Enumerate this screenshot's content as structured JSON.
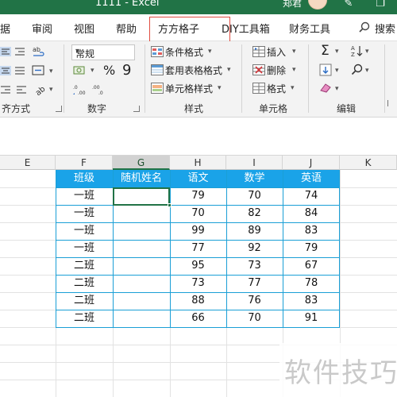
{
  "window": {
    "title": "1111  -  Excel",
    "user_name": "郑君"
  },
  "menu": {
    "tabs": [
      "据",
      "审阅",
      "视图",
      "帮助",
      "方方格子",
      "DIY工具箱",
      "财务工具"
    ],
    "search_label": "搜索"
  },
  "ribbon": {
    "alignment_group": "齐方式",
    "number": {
      "format_value": "常规",
      "percent_symbol": "%",
      "comma_symbol": "9",
      "group_label": "数字"
    },
    "styles": {
      "conditional_format": "条件格式",
      "format_as_table": "套用表格格式",
      "cell_styles": "单元格样式",
      "group_label": "样式"
    },
    "cells": {
      "insert": "插入",
      "delete": "删除",
      "format": "格式",
      "group_label": "单元格"
    },
    "editing": {
      "group_label": "编辑"
    }
  },
  "sheet": {
    "columns": [
      "E",
      "F",
      "G",
      "H",
      "I",
      "J",
      "K"
    ],
    "selected_column": "G",
    "table": {
      "headers": [
        "班级",
        "随机姓名",
        "语文",
        "数学",
        "英语"
      ],
      "rows": [
        [
          "一班",
          "",
          "79",
          "70",
          "74"
        ],
        [
          "一班",
          "",
          "70",
          "82",
          "84"
        ],
        [
          "一班",
          "",
          "99",
          "89",
          "83"
        ],
        [
          "一班",
          "",
          "77",
          "92",
          "79"
        ],
        [
          "二班",
          "",
          "95",
          "73",
          "67"
        ],
        [
          "二班",
          "",
          "73",
          "77",
          "78"
        ],
        [
          "二班",
          "",
          "88",
          "76",
          "83"
        ],
        [
          "二班",
          "",
          "66",
          "70",
          "91"
        ]
      ]
    }
  },
  "watermark": "软件技巧",
  "colors": {
    "excel_green": "#217346",
    "table_header": "#1aa3e8",
    "highlight_box": "#e04b3f"
  }
}
